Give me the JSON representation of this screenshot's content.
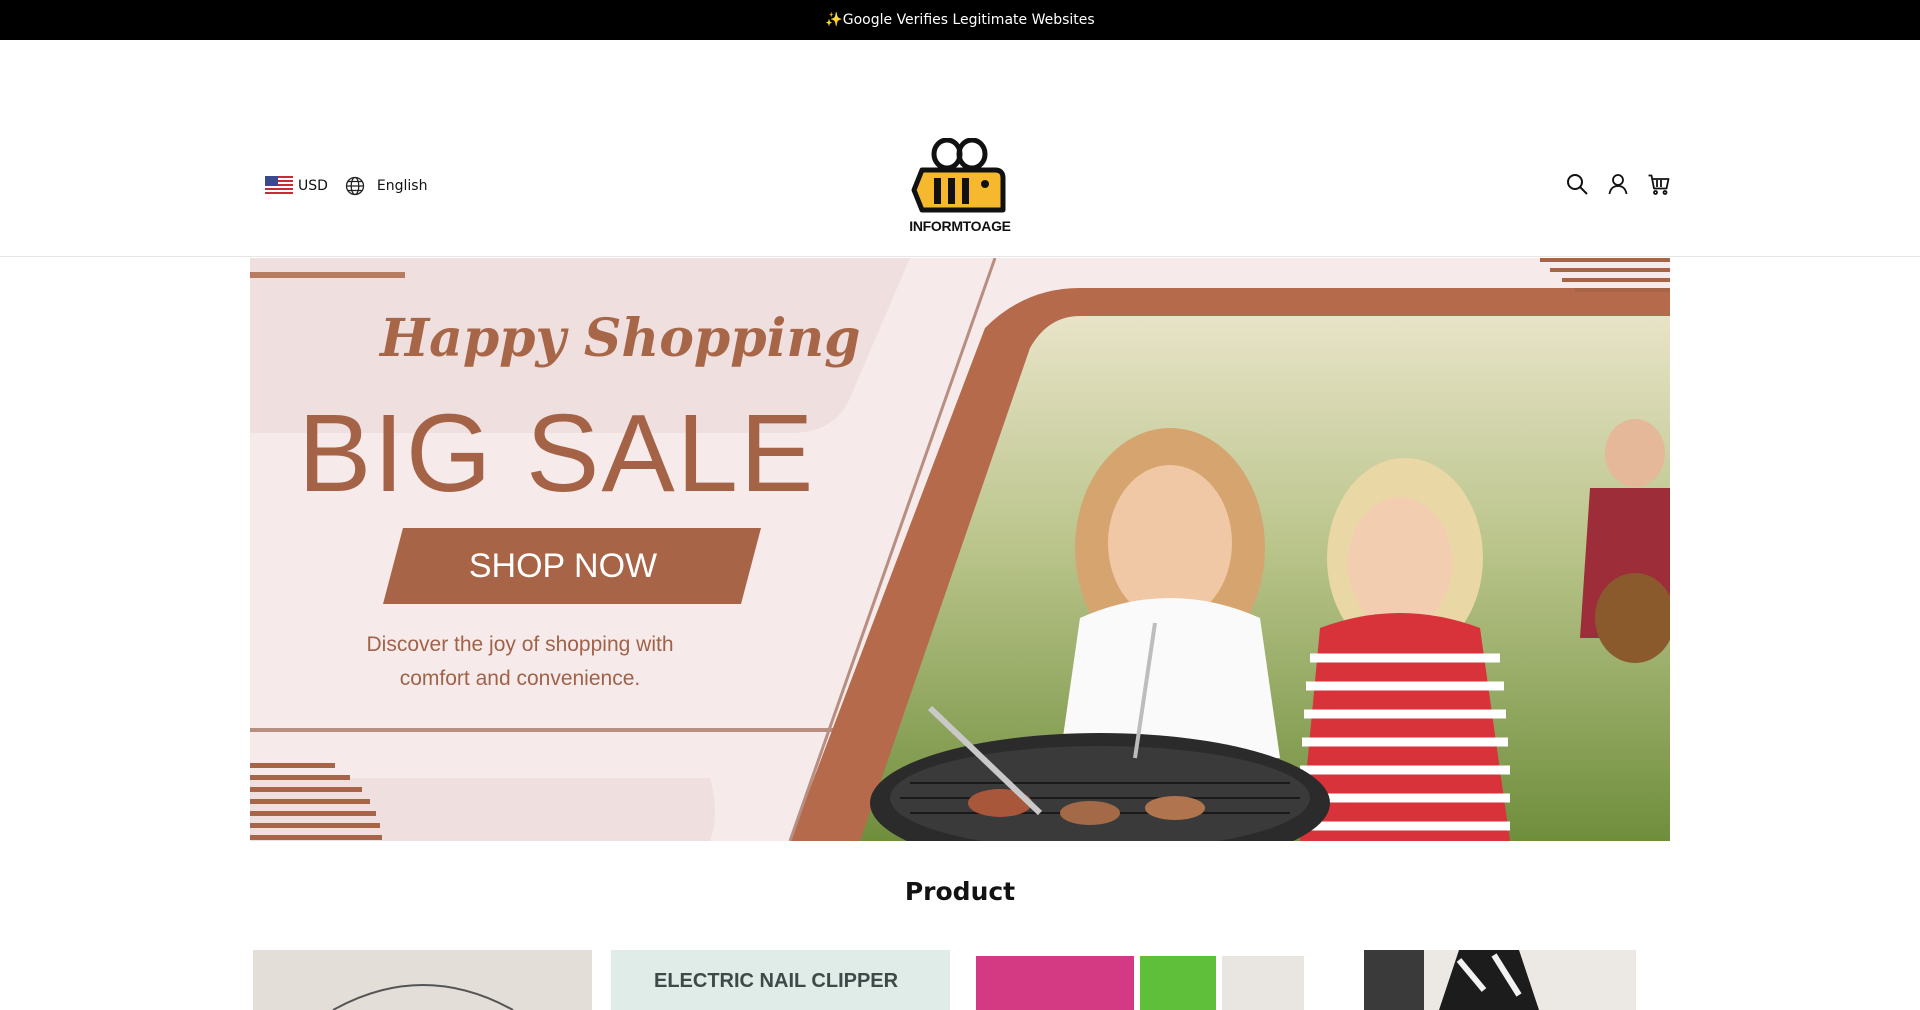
{
  "announcement": {
    "text": "✨Google Verifies Legitimate Websites"
  },
  "header": {
    "currency": "USD",
    "language": "English",
    "logo_text": "INFORMTOAGE",
    "icons": [
      "search-icon",
      "account-icon",
      "cart-icon"
    ]
  },
  "banner": {
    "headline_script": "Happy Shopping",
    "headline": "BIG SALE",
    "cta": "SHOP NOW",
    "description": "Discover the joy of shopping with comfort and convenience.",
    "accent_color": "#a86446"
  },
  "products_section": {
    "title": "Product",
    "visible_card_text": "ELECTRIC NAIL CLIPPER"
  }
}
